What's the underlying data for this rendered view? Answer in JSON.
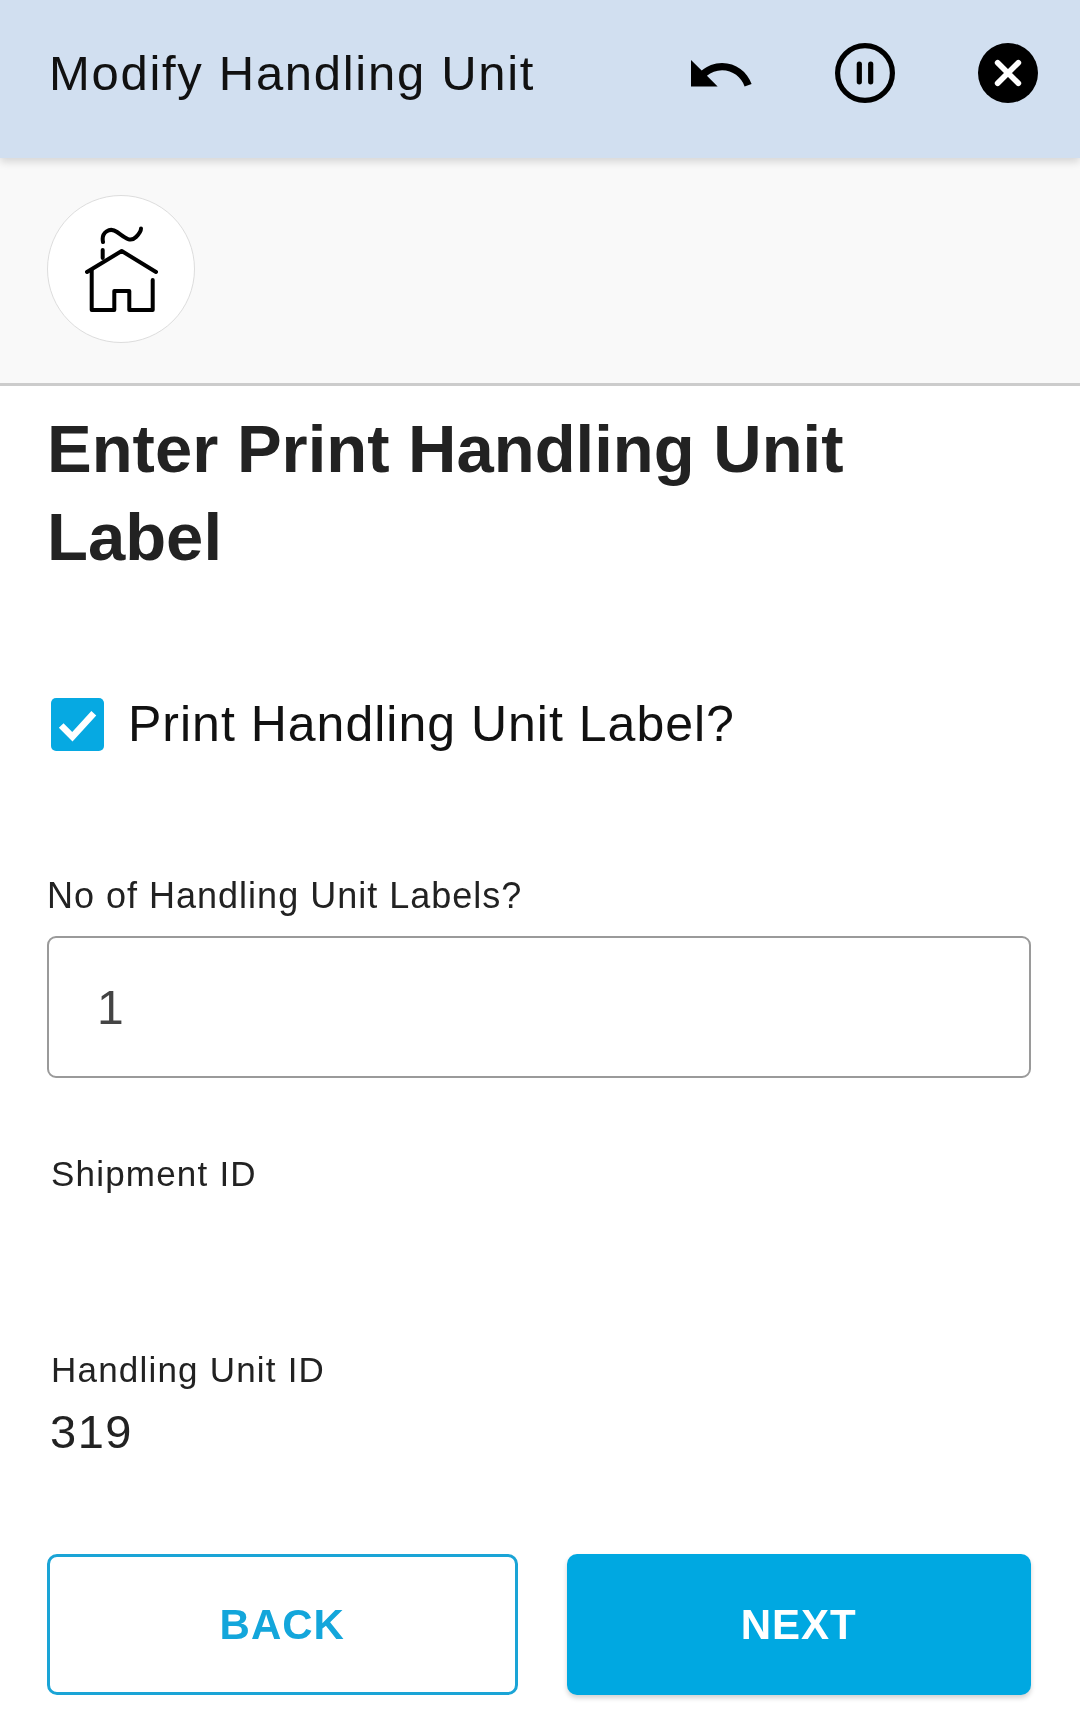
{
  "header": {
    "title": "Modify Handling Unit"
  },
  "page_heading": "Enter Print Handling Unit Label",
  "form": {
    "fields": [
      {
        "kind": "checkbox",
        "label": "Print Handling Unit Label?",
        "checked": true
      },
      {
        "kind": "input",
        "label": "No of Handling Unit Labels?",
        "value": "1"
      },
      {
        "kind": "readonly",
        "label": "Shipment ID"
      },
      {
        "kind": "readonly",
        "label": "Handling Unit ID",
        "value": "319"
      }
    ]
  },
  "buttons": [
    {
      "label": "BACK",
      "kind": "outline"
    },
    {
      "label": "NEXT",
      "kind": "filled"
    }
  ]
}
